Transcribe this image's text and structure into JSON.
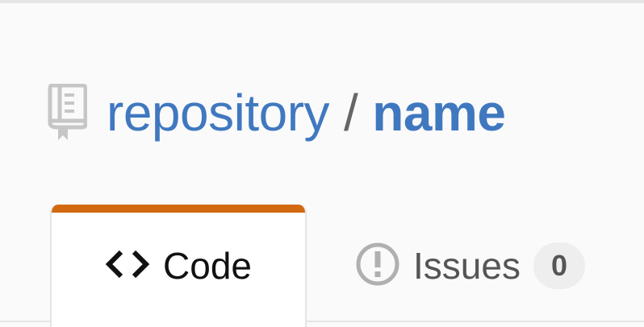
{
  "colors": {
    "link_blue": "#4078c0",
    "tab_accent": "#d26911",
    "separator_gray": "#666666",
    "counter_bg": "#eeeeee"
  },
  "repo": {
    "icon": "repo-book-icon",
    "owner": "repository",
    "separator": "/",
    "name": "name"
  },
  "tabs": [
    {
      "id": "code",
      "icon": "code-brackets-icon",
      "label": "Code",
      "selected": true
    },
    {
      "id": "issues",
      "icon": "issue-opened-icon",
      "label": "Issues",
      "counter": "0",
      "selected": false
    }
  ]
}
